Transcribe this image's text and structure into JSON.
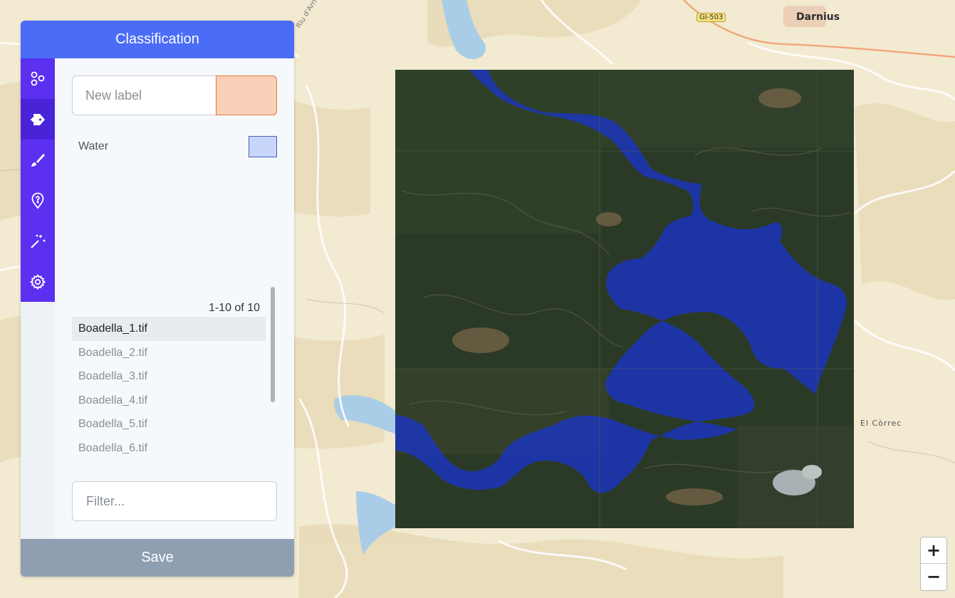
{
  "panel": {
    "title": "Classification",
    "new_label_placeholder": "New label",
    "labels": [
      {
        "name": "Water",
        "color": "#c9d6fb"
      }
    ],
    "new_label_color": "#fbd0b8",
    "sidebar": [
      {
        "icon": "clusters-icon",
        "active": false
      },
      {
        "icon": "tag-add-icon",
        "active": true
      },
      {
        "icon": "brush-icon",
        "active": false
      },
      {
        "icon": "map-pin-question-icon",
        "active": false
      },
      {
        "icon": "magic-wand-icon",
        "active": false
      },
      {
        "icon": "gear-icon",
        "active": false
      }
    ],
    "files": {
      "count_text": "1-10 of 10",
      "items": [
        "Boadella_1.tif",
        "Boadella_2.tif",
        "Boadella_3.tif",
        "Boadella_4.tif",
        "Boadella_5.tif",
        "Boadella_6.tif"
      ],
      "selected_index": 0
    },
    "filter_placeholder": "Filter...",
    "save_label": "Save"
  },
  "map": {
    "places": {
      "darnius": "Darnius",
      "correc": "El Còrrec",
      "road": "GI-503",
      "river": "Riu d'Arnera"
    },
    "zoom_in": "+",
    "zoom_out": "−"
  },
  "colors": {
    "header": "#4a6cf7",
    "sidebar": "#5b30f0",
    "water_overlay": "#1a34c8"
  }
}
